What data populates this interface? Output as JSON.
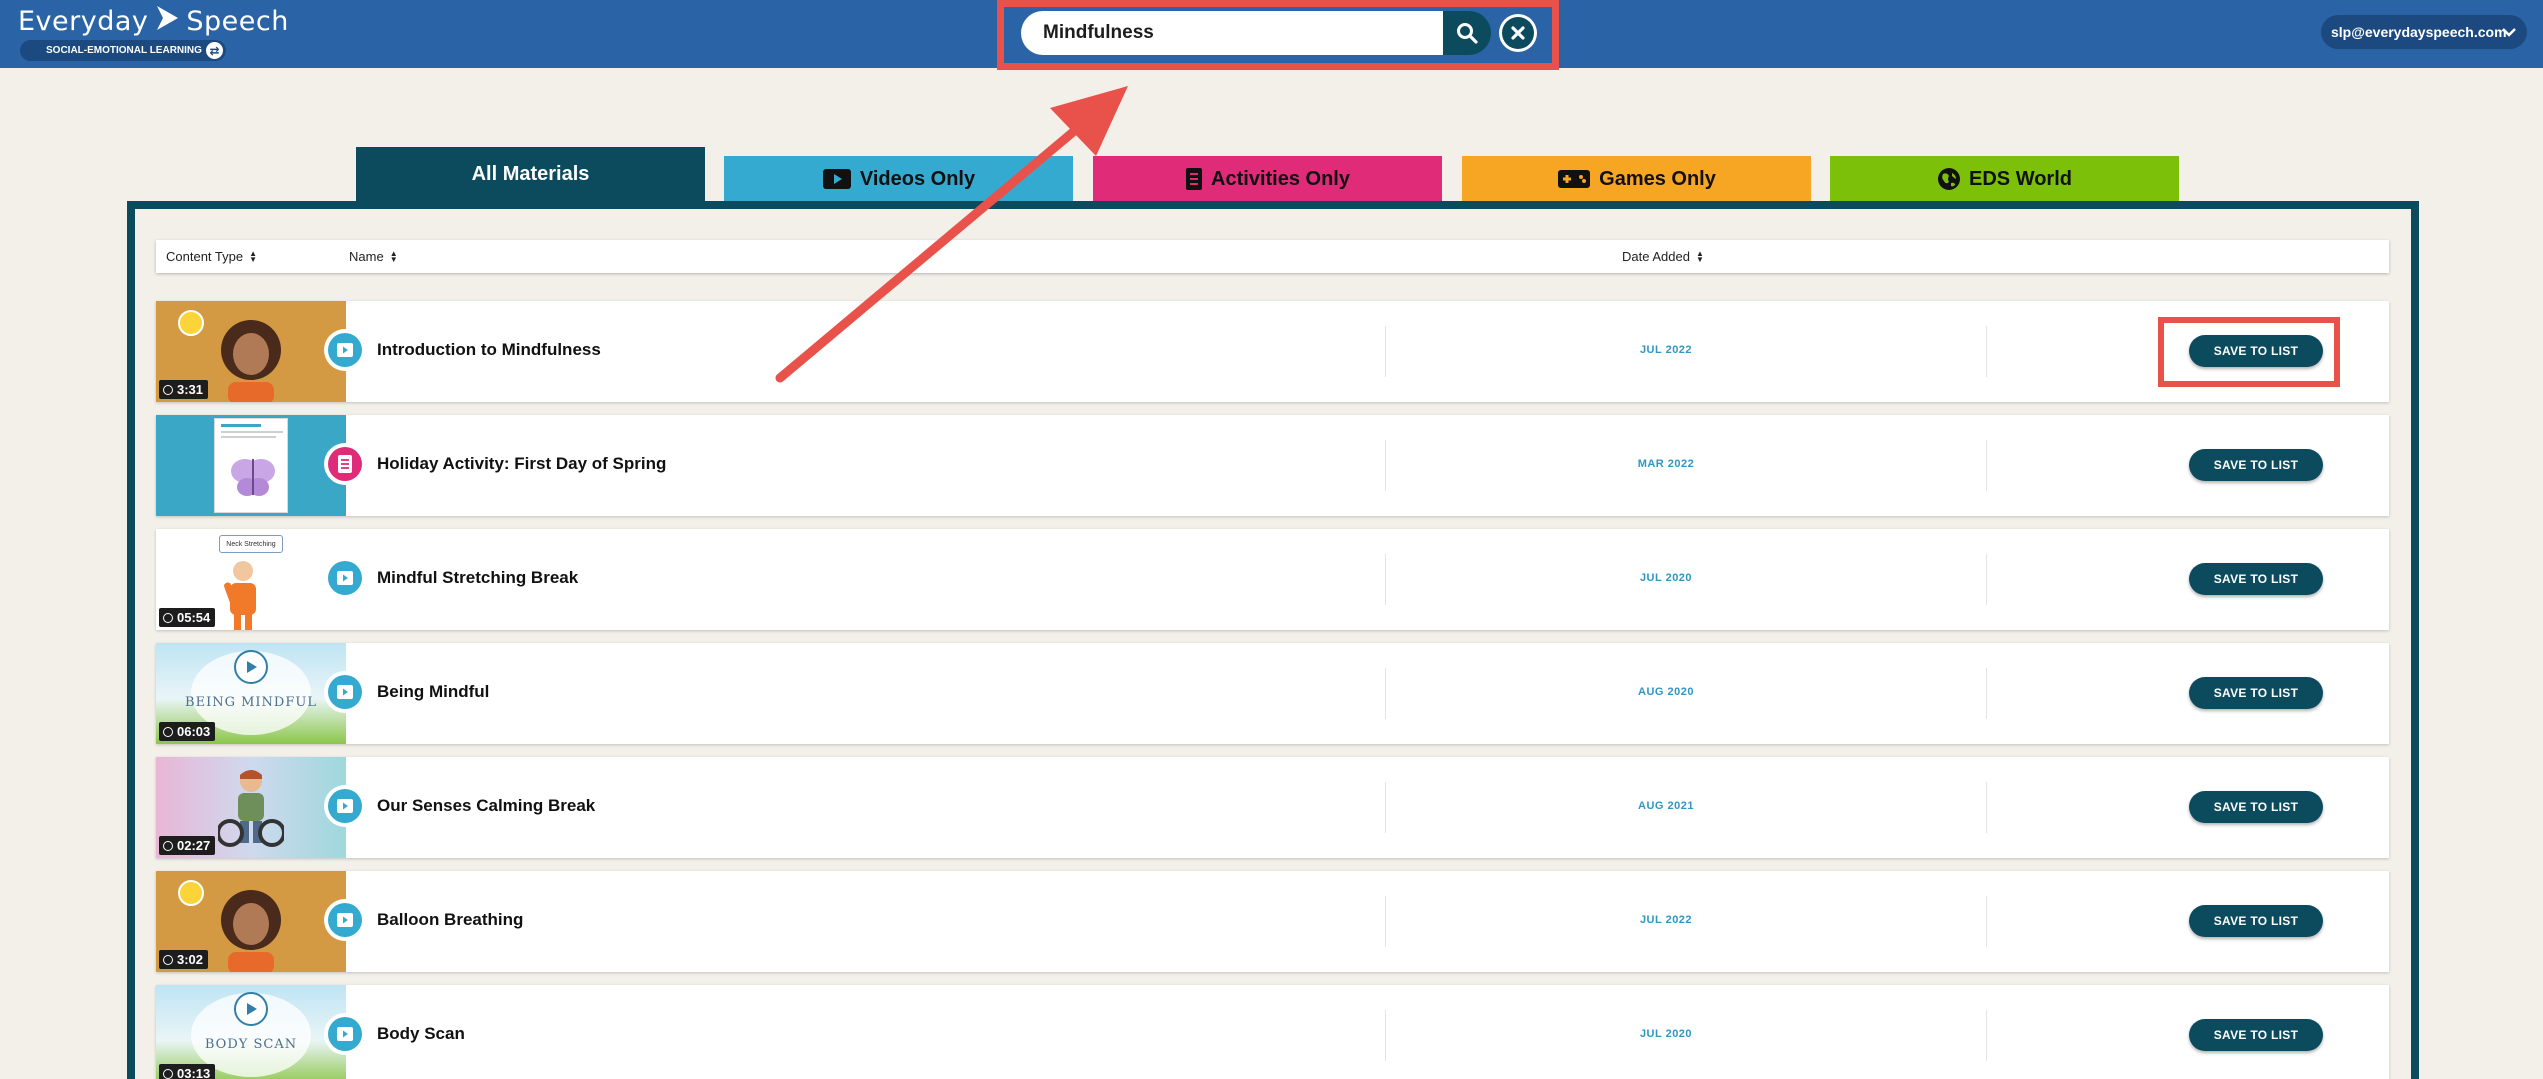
{
  "header": {
    "brand_left": "Everyday",
    "brand_right": "Speech",
    "product_badge": "SOCIAL-EMOTIONAL LEARNING",
    "search": {
      "value": "Mindfulness"
    },
    "account_email": "slp@everydayspeech.com"
  },
  "tabs": [
    {
      "label": "All Materials",
      "icon": "none",
      "active": true
    },
    {
      "label": "Videos Only",
      "icon": "video-icon"
    },
    {
      "label": "Activities Only",
      "icon": "document-icon"
    },
    {
      "label": "Games Only",
      "icon": "gamepad-icon"
    },
    {
      "label": "EDS World",
      "icon": "globe-icon"
    }
  ],
  "sort_bar": {
    "content_type": "Content Type",
    "name": "Name",
    "date_added": "Date Added"
  },
  "rows": [
    {
      "title": "Introduction to Mindfulness",
      "type": "video",
      "duration": "3:31",
      "date": "JUL 2022",
      "action": "SAVE TO LIST"
    },
    {
      "title": "Holiday Activity: First Day of Spring",
      "type": "activity",
      "duration": "",
      "date": "MAR 2022",
      "action": "SAVE TO LIST"
    },
    {
      "title": "Mindful Stretching Break",
      "type": "video",
      "duration": "05:54",
      "date": "JUL 2020",
      "action": "SAVE TO LIST",
      "thumb_caption": "Neck Stretching"
    },
    {
      "title": "Being Mindful",
      "type": "video",
      "duration": "06:03",
      "date": "AUG 2020",
      "action": "SAVE TO LIST",
      "thumb_caption": "BEING MINDFUL"
    },
    {
      "title": "Our Senses Calming Break",
      "type": "video",
      "duration": "02:27",
      "date": "AUG 2021",
      "action": "SAVE TO LIST"
    },
    {
      "title": "Balloon Breathing",
      "type": "video",
      "duration": "3:02",
      "date": "JUL 2022",
      "action": "SAVE TO LIST"
    },
    {
      "title": "Body Scan",
      "type": "video",
      "duration": "03:13",
      "date": "JUL 2020",
      "action": "SAVE TO LIST",
      "thumb_caption": "BODY SCAN"
    }
  ],
  "colors": {
    "header_bg": "#2a64a6",
    "dark_teal": "#0c4a5e",
    "videos_tab": "#35aad1",
    "activities_tab": "#e02b79",
    "games_tab": "#f6a622",
    "world_tab": "#7cc00a",
    "annotation_red": "#e8524a"
  }
}
